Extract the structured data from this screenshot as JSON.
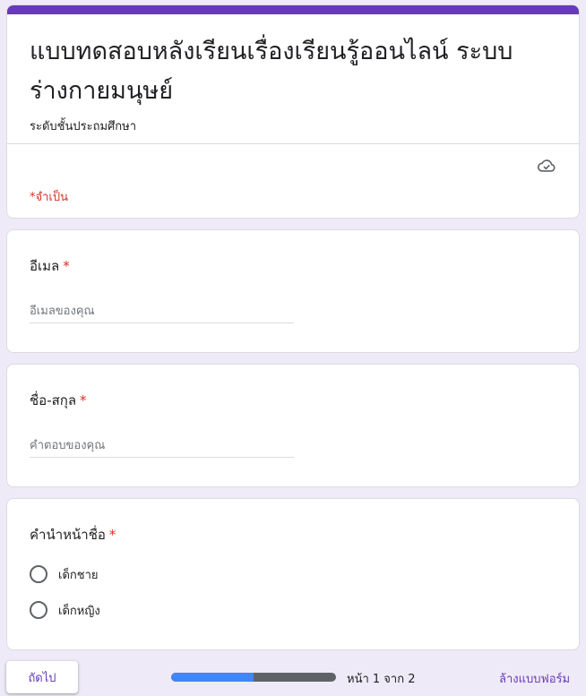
{
  "form": {
    "title": "แบบทดสอบหลังเรียนเรื่องเรียนรู้ออนไลน์ ระบบร่างกายมนุษย์",
    "description": "ระดับชั้นประถมศึกษา",
    "required_note": "*จำเป็น",
    "accent_color": "#673ab7",
    "required_color": "#d93025"
  },
  "questions": [
    {
      "label": "อีเมล",
      "required_mark": "*",
      "placeholder": "อีเมลของคุณ"
    },
    {
      "label": "ชื่อ-สกุล",
      "required_mark": "*",
      "placeholder": "คำตอบของคุณ"
    },
    {
      "label": "คำนำหน้าชื่อ",
      "required_mark": "*",
      "options": [
        "เด็กชาย",
        "เด็กหญิง"
      ]
    }
  ],
  "footer": {
    "next_label": "ถัดไป",
    "page_indicator": "หน้า 1 จาก 2",
    "progress": 0.5,
    "clear_label": "ล้างแบบฟอร์ม"
  },
  "icons": {
    "save_status": "cloud-check-icon"
  }
}
